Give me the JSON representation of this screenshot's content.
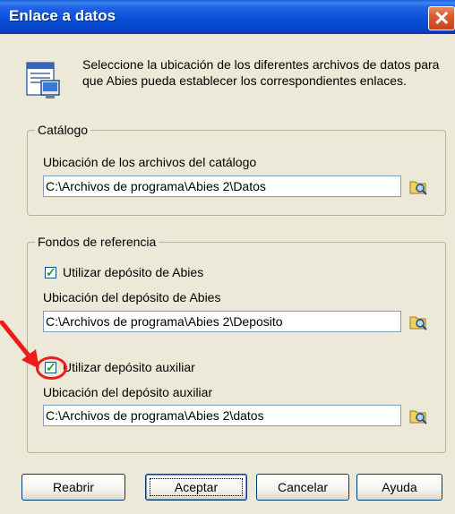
{
  "window": {
    "title": "Enlace a datos",
    "close_glyph": "✕"
  },
  "intro": {
    "icon": "database-link-icon",
    "text": "Seleccione la ubicación de los diferentes archivos de datos para que Abies pueda establecer los correspondientes enlaces."
  },
  "catalogo": {
    "legend": "Catálogo",
    "label": "Ubicación de los archivos del catálogo",
    "path": "C:\\Archivos de programa\\Abies 2\\Datos"
  },
  "fondos": {
    "legend": "Fondos de referencia",
    "use_abies_label": "Utilizar depósito de Abies",
    "use_abies_checked": true,
    "abies_location_label": "Ubicación del depósito de Abies",
    "abies_path": "C:\\Archivos de programa\\Abies 2\\Deposito",
    "use_aux_label": "Utilizar depósito auxiliar",
    "use_aux_checked": true,
    "aux_location_label": "Ubicación del depósito auxiliar",
    "aux_path": "C:\\Archivos de programa\\Abies 2\\datos"
  },
  "buttons": {
    "reopen": "Reabrir",
    "accept": "Aceptar",
    "cancel": "Cancelar",
    "help": "Ayuda"
  },
  "colors": {
    "titlebar": "#0a50d8",
    "dialog_bg": "#ece9d8",
    "annotation": "#ef1b1b"
  }
}
